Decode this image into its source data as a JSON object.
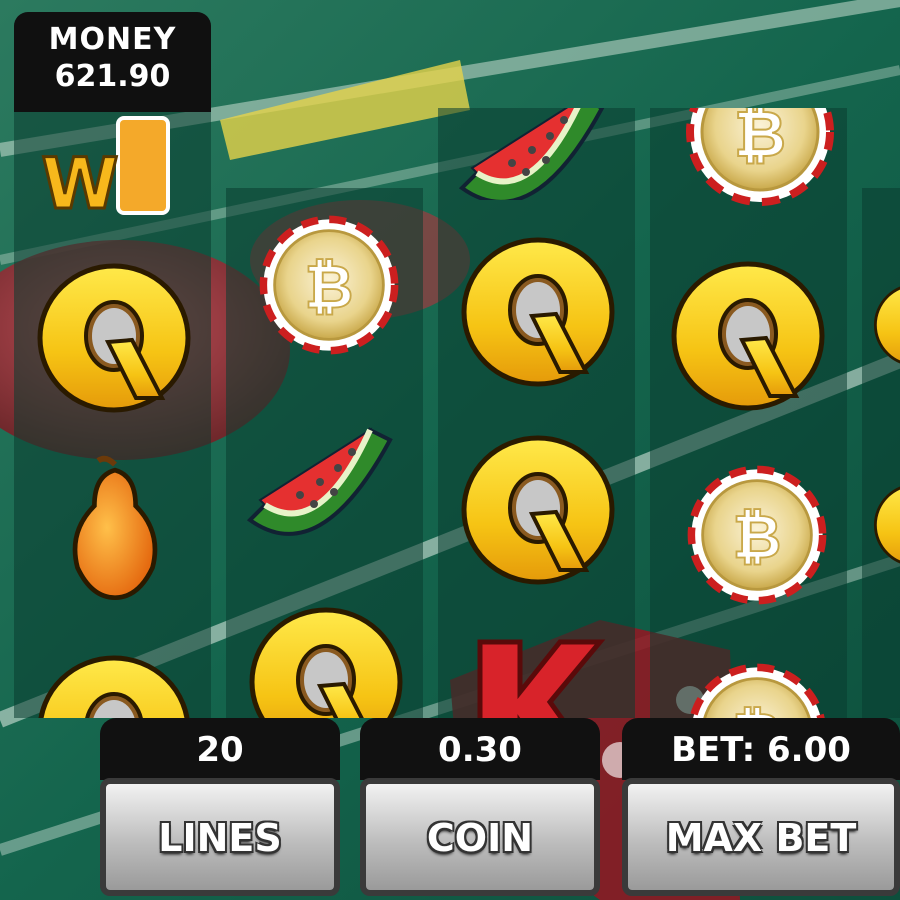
{
  "money": {
    "label": "MONEY",
    "value": "621.90"
  },
  "controls": {
    "lines": {
      "value": "20",
      "button_label": "LINES"
    },
    "coin": {
      "value": "0.30",
      "button_label": "COIN"
    },
    "bet": {
      "value": "BET: 6.00",
      "button_label": "MAX BET"
    }
  },
  "reels": [
    [
      "wild-juice-icon",
      "q-icon",
      "pear-icon",
      "q-icon"
    ],
    [
      "bitcoin-chip-icon",
      "watermelon-icon",
      "q-icon"
    ],
    [
      "watermelon-icon",
      "q-icon",
      "q-icon",
      "k-icon"
    ],
    [
      "bitcoin-chip-icon",
      "q-icon",
      "bitcoin-chip-icon",
      "bitcoin-chip-icon"
    ],
    [
      "q-icon",
      "q-icon"
    ]
  ],
  "colors": {
    "felt": "#0f5a45",
    "symbol_yellow": "#f7d21c",
    "panel": "#111111"
  }
}
